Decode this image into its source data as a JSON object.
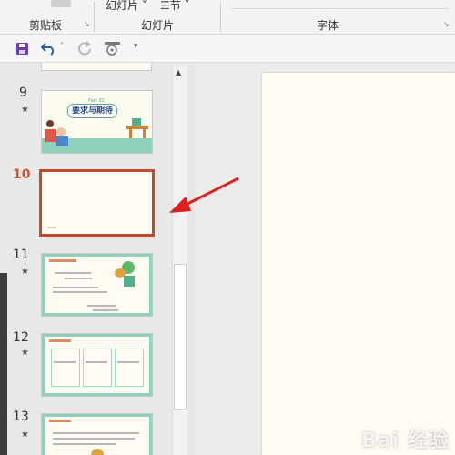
{
  "ribbon": {
    "clipboard_label": "剪贴板",
    "slides_label": "幻灯片",
    "font_label": "字体",
    "new_slide_label": "幻灯片",
    "section_label": "节"
  },
  "thumbnails": [
    {
      "number": "9",
      "star": "★",
      "title": "Part 02",
      "heading": "要求与期待"
    },
    {
      "number": "10",
      "star": "",
      "title": "",
      "heading": ""
    },
    {
      "number": "11",
      "star": "★",
      "title": "",
      "heading": ""
    },
    {
      "number": "12",
      "star": "★",
      "title": "",
      "heading": ""
    },
    {
      "number": "13",
      "star": "★",
      "title": "",
      "heading": ""
    }
  ],
  "colors": {
    "accent_red": "#c24a2c",
    "mint": "#8fd1b9",
    "arrow": "#e02020"
  },
  "watermark": "Bai 经验"
}
